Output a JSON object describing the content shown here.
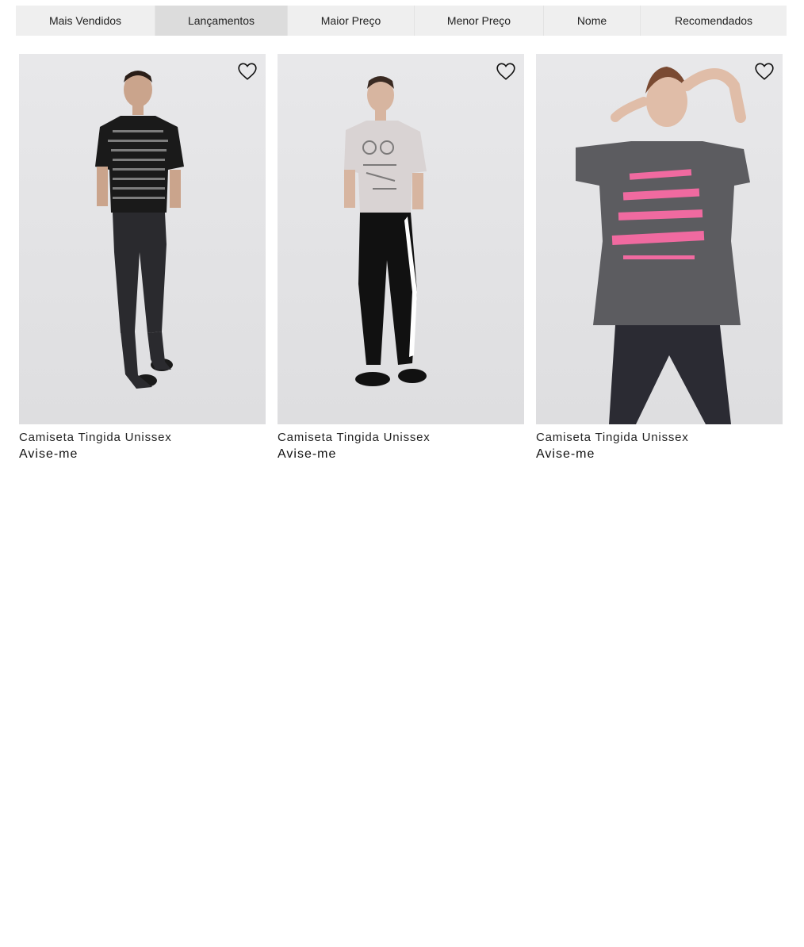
{
  "sort_tabs": [
    {
      "label": "Mais Vendidos",
      "active": false
    },
    {
      "label": "Lançamentos",
      "active": true
    },
    {
      "label": "Maior Preço",
      "active": false
    },
    {
      "label": "Menor Preço",
      "active": false
    },
    {
      "label": "Nome",
      "active": false
    },
    {
      "label": "Recomendados",
      "active": false
    }
  ],
  "products": [
    {
      "name": "Camiseta Tingida Unissex",
      "price_label": "Avise-me",
      "favorite_icon": "heart-outline-icon",
      "shirt_color": "#1a1a1a",
      "pants_color": "#2a2a2e"
    },
    {
      "name": "Camiseta Tingida Unissex",
      "price_label": "Avise-me",
      "favorite_icon": "heart-outline-icon",
      "shirt_color": "#d9d3d3",
      "pants_color": "#111111"
    },
    {
      "name": "Camiseta Tingida Unissex",
      "price_label": "Avise-me",
      "favorite_icon": "heart-outline-icon",
      "shirt_color": "#5c5c60",
      "pants_color": "#2b2b33",
      "print_color": "#f06aa0"
    }
  ]
}
